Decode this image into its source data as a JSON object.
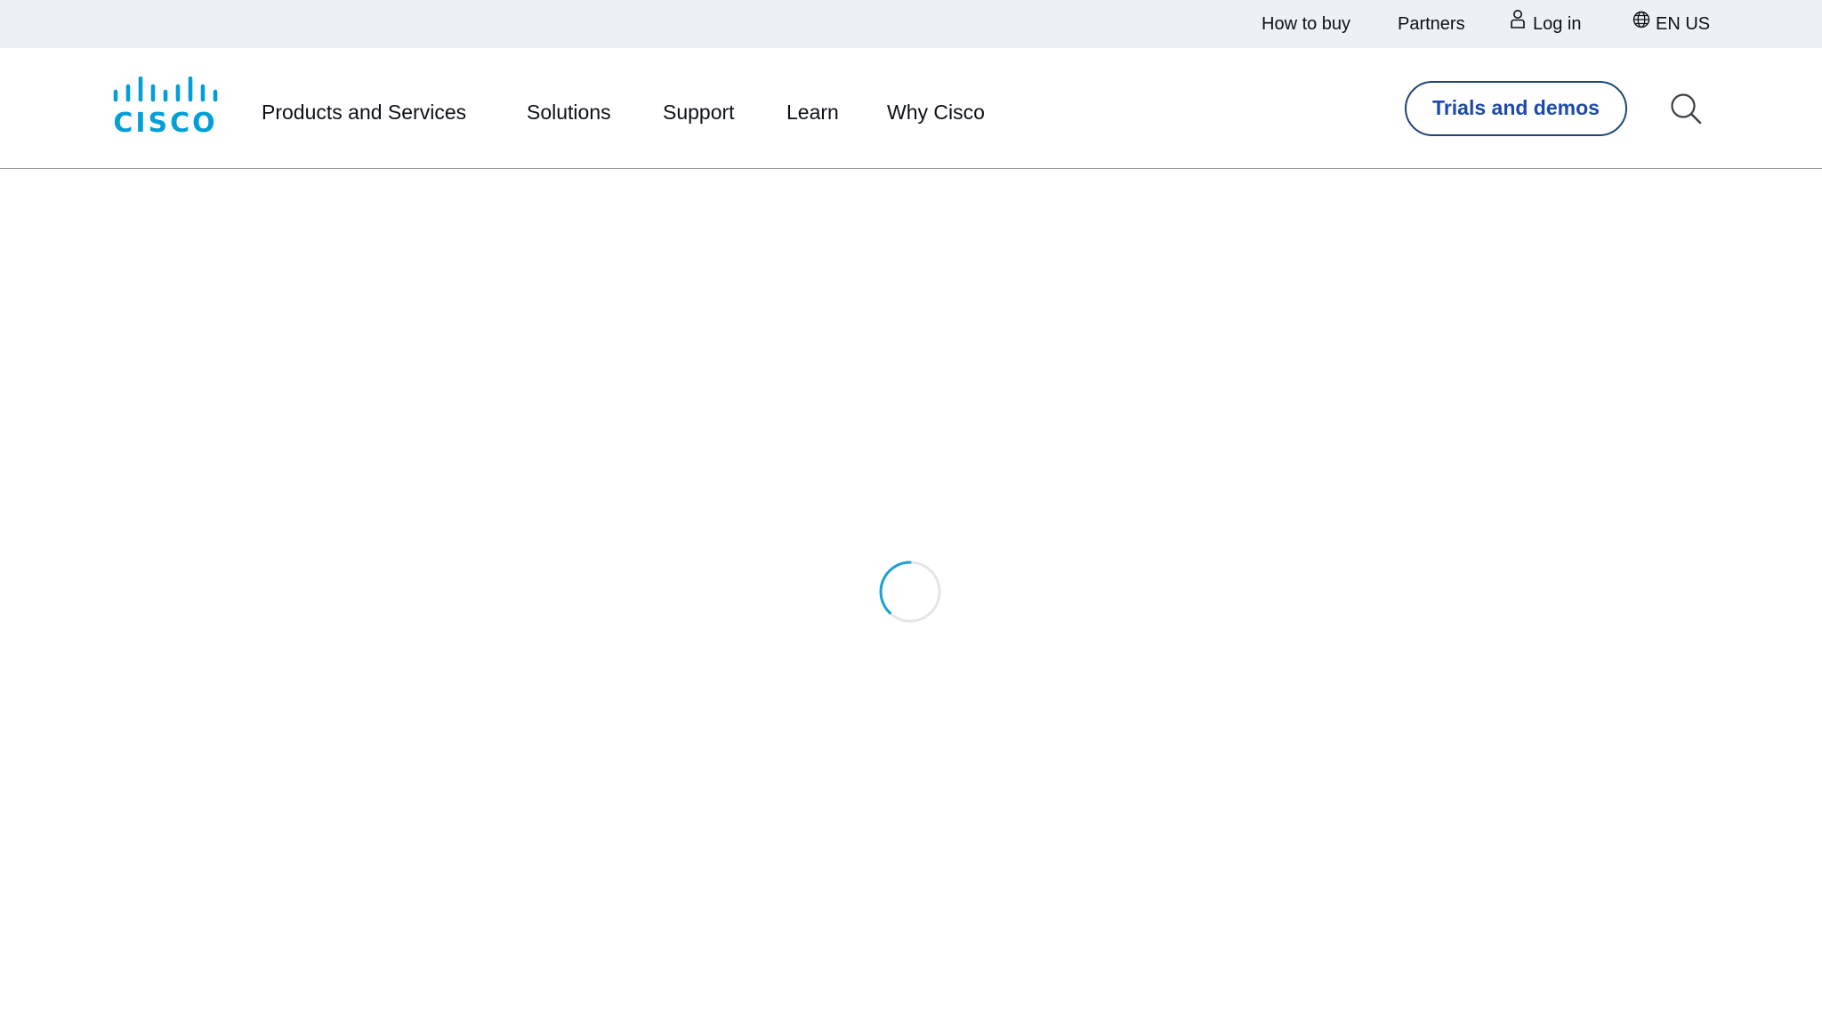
{
  "utility_bar": {
    "how_to_buy": "How to buy",
    "partners": "Partners",
    "log_in": "Log in",
    "language": "EN US",
    "login_icon": "user-icon",
    "language_icon": "globe-icon"
  },
  "header": {
    "logo_text": "CISCO",
    "nav": {
      "products": "Products and Services",
      "solutions": "Solutions",
      "support": "Support",
      "learn": "Learn",
      "why": "Why Cisco"
    },
    "trials_label": "Trials and demos",
    "search_icon": "search-icon"
  },
  "main": {
    "loading_icon": "loading-spinner-icon"
  },
  "colors": {
    "brand": "#049fd9",
    "button_text": "#1d4aa8",
    "utility_bg": "#ecf1f4"
  }
}
